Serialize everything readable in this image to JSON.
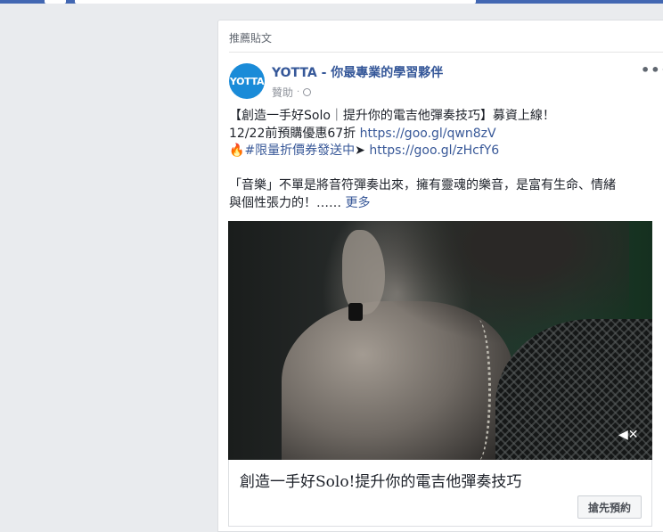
{
  "section_header": "推薦貼文",
  "post": {
    "avatar_text": "YOTTA",
    "page_name": "YOTTA - 你最專業的學習夥伴",
    "sponsored": "贊助",
    "separator": "·",
    "more_icon": "•••",
    "text": {
      "line1": "【創造一手好Solo｜提升你的電吉他彈奏技巧】募資上線！",
      "line2_prefix": "12/22前預購優惠67折 ",
      "line2_link": "https://goo.gl/qwn8zV",
      "line3_emoji": "🔥",
      "line3_tag": "#限量折價券發送中",
      "line3_arrow": "➤ ",
      "line3_link": "https://goo.gl/zHcfY6",
      "line4": "「音樂」不單是將音符彈奏出來，擁有靈魂的樂音，是富有生命、情緒",
      "line5_prefix": "與個性張力的！…… ",
      "see_more": "更多"
    },
    "video": {
      "mute_icon": "◀✕"
    },
    "cta": {
      "title": "創造一手好Solo!提升你的電吉他彈奏技巧",
      "button": "搶先預約"
    }
  },
  "colors": {
    "accent": "#4267b2",
    "link": "#385898",
    "name": "#365899"
  }
}
